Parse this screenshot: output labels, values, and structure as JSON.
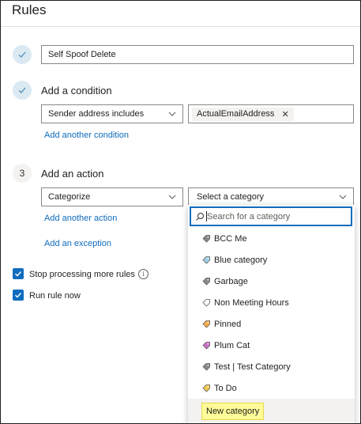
{
  "page": {
    "title": "Rules"
  },
  "rule": {
    "name": "Self Spoof Delete"
  },
  "condition": {
    "heading": "Add a condition",
    "field": "Sender address includes",
    "chip_value": "ActualEmailAddress",
    "add_link": "Add another condition"
  },
  "action": {
    "step_number": "3",
    "heading": "Add an action",
    "field": "Categorize",
    "category_placeholder": "Select a category",
    "add_link": "Add another action",
    "exception_link": "Add an exception"
  },
  "options": {
    "stop_processing": "Stop processing more rules",
    "run_now": "Run rule now"
  },
  "category_menu": {
    "search_placeholder": "Search for a category",
    "items": [
      {
        "label": "BCC Me",
        "color": "#8a8886"
      },
      {
        "label": "Blue category",
        "color": "#9fd0e8"
      },
      {
        "label": "Garbage",
        "color": "#8a8886"
      },
      {
        "label": "Non Meeting Hours",
        "color": "#ffffff"
      },
      {
        "label": "Pinned",
        "color": "#f7a94a"
      },
      {
        "label": "Plum Cat",
        "color": "#c86fc6"
      },
      {
        "label": "Test | Test Category",
        "color": "#8a8886"
      },
      {
        "label": "To Do",
        "color": "#f2c94c"
      }
    ],
    "new_category": "New category"
  },
  "colors": {
    "accent": "#0f6cbd",
    "highlight": "#fffb99"
  }
}
